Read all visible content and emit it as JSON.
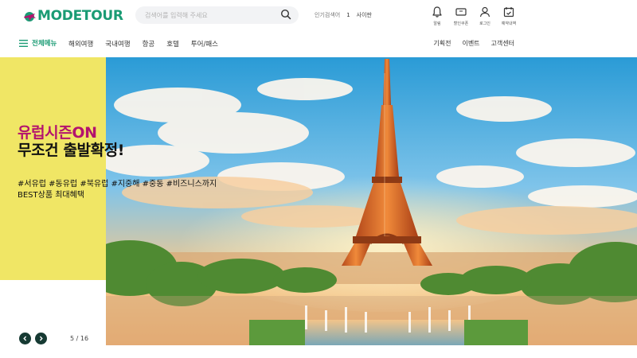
{
  "brand": {
    "logo_text": "MODETOUR",
    "colors": {
      "primary": "#1a9b74",
      "accent": "#b3136e",
      "banner_bg": "#f0e665",
      "dark": "#163a33"
    }
  },
  "search": {
    "placeholder": "검색어를 입력해 주세요",
    "icon": "search-icon"
  },
  "popular_keywords": {
    "label": "인기검색어",
    "rank": "1",
    "keyword": "사이판"
  },
  "utility_menu": [
    {
      "label": "알림",
      "icon": "bell-icon"
    },
    {
      "label": "할인쿠폰",
      "icon": "ticket-icon"
    },
    {
      "label": "로그인",
      "icon": "user-icon"
    },
    {
      "label": "예약내역",
      "icon": "calendar-icon"
    }
  ],
  "nav": {
    "all_menu": "전체메뉴",
    "main": [
      "해외여행",
      "국내여행",
      "항공",
      "호텔",
      "투어/패스"
    ],
    "right": [
      "기획전",
      "이벤트",
      "고객센터"
    ]
  },
  "hero": {
    "title_line1": "유럽시즌ON",
    "title_line2": "무조건 출발확정!",
    "tags": "#서유럽 #동유럽 #북유럽 #지중해 #중동 #비즈니스까지",
    "subtitle": "BEST상품 최대혜택",
    "pager": {
      "current": "5",
      "total": "16",
      "text": "5 / 16"
    }
  }
}
